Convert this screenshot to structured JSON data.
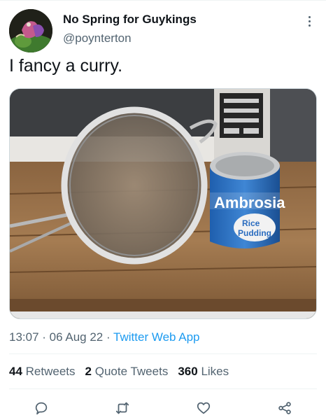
{
  "author": {
    "display_name": "No Spring for Guykings",
    "handle": "@poynterton"
  },
  "tweet": {
    "text": "I fancy a curry."
  },
  "media": {
    "can_brand": "Ambrosia",
    "can_label_lines": [
      "Rice",
      "Pudding"
    ]
  },
  "meta": {
    "time": "13:07",
    "separator": " · ",
    "date": "06 Aug 22",
    "source": "Twitter Web App"
  },
  "stats": {
    "retweets_count": "44",
    "retweets_label": "Retweets",
    "quotes_count": "2",
    "quotes_label": "Quote Tweets",
    "likes_count": "360",
    "likes_label": "Likes"
  },
  "colors": {
    "link_blue": "#1d9bf0",
    "secondary_text": "#536471"
  },
  "actions": [
    "reply-icon",
    "retweet-icon",
    "like-icon",
    "share-icon"
  ]
}
